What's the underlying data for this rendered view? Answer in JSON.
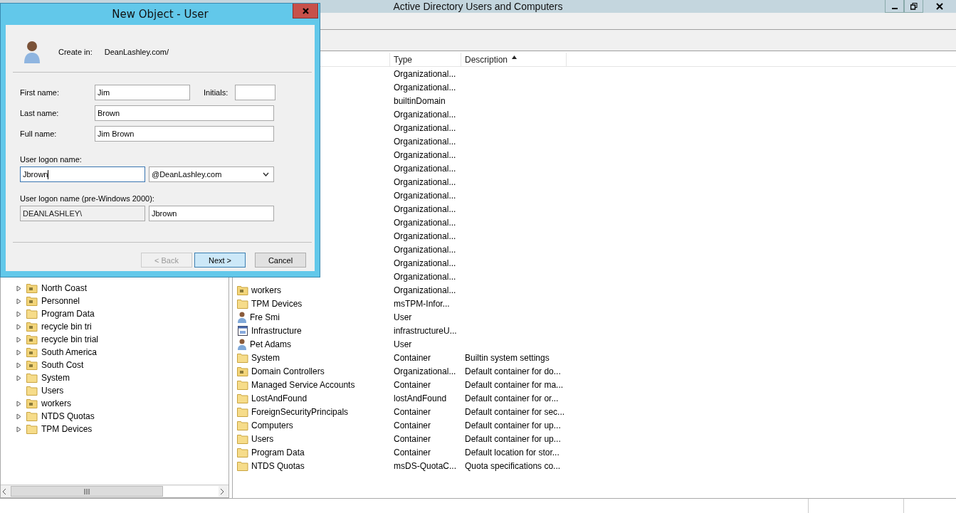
{
  "main_window": {
    "title": "Active Directory Users and Computers"
  },
  "tree": {
    "items": [
      {
        "label": "North Coast",
        "kind": "ou",
        "expandable": true
      },
      {
        "label": "Personnel",
        "kind": "ou",
        "expandable": true
      },
      {
        "label": "Program Data",
        "kind": "container",
        "expandable": true
      },
      {
        "label": "recycle bin tri",
        "kind": "ou",
        "expandable": true
      },
      {
        "label": "recycle bin trial",
        "kind": "ou",
        "expandable": true
      },
      {
        "label": "South America",
        "kind": "ou",
        "expandable": true
      },
      {
        "label": "South Cost",
        "kind": "ou",
        "expandable": true
      },
      {
        "label": "System",
        "kind": "container",
        "expandable": true
      },
      {
        "label": "Users",
        "kind": "container",
        "expandable": false
      },
      {
        "label": "workers",
        "kind": "ou",
        "expandable": true
      },
      {
        "label": "NTDS Quotas",
        "kind": "container",
        "expandable": true
      },
      {
        "label": "TPM Devices",
        "kind": "container",
        "expandable": true
      }
    ]
  },
  "list": {
    "columns": [
      {
        "label": "Type",
        "sorted": false
      },
      {
        "label": "Description",
        "sorted": true
      }
    ],
    "rows": [
      {
        "type": "Organizational..."
      },
      {
        "type": "Organizational..."
      },
      {
        "type": "builtinDomain"
      },
      {
        "type": "Organizational..."
      },
      {
        "type": "Organizational..."
      },
      {
        "type": "Organizational..."
      },
      {
        "type": "Organizational..."
      },
      {
        "type": "Organizational..."
      },
      {
        "type": "Organizational..."
      },
      {
        "type": "Organizational..."
      },
      {
        "type": "Organizational..."
      },
      {
        "type": "Organizational..."
      },
      {
        "type": "Organizational..."
      },
      {
        "type": "Organizational..."
      },
      {
        "type": "Organizational..."
      },
      {
        "type": "Organizational..."
      },
      {
        "kind": "ou",
        "name": "workers",
        "type": "Organizational..."
      },
      {
        "kind": "container",
        "name": "TPM Devices",
        "type": "msTPM-Infor..."
      },
      {
        "kind": "user",
        "name": "Fre Smi",
        "type": "User"
      },
      {
        "kind": "infrastructure",
        "name": "Infrastructure",
        "type": "infrastructureU..."
      },
      {
        "kind": "user",
        "name": "Pet Adams",
        "type": "User"
      },
      {
        "kind": "container",
        "name": "System",
        "type": "Container",
        "description": "Builtin system settings"
      },
      {
        "kind": "ou",
        "name": "Domain Controllers",
        "type": "Organizational...",
        "description": "Default container for do..."
      },
      {
        "kind": "container",
        "name": "Managed Service Accounts",
        "type": "Container",
        "description": "Default container for ma..."
      },
      {
        "kind": "container",
        "name": "LostAndFound",
        "type": "lostAndFound",
        "description": "Default container for or..."
      },
      {
        "kind": "container",
        "name": "ForeignSecurityPrincipals",
        "type": "Container",
        "description": "Default container for sec..."
      },
      {
        "kind": "container",
        "name": "Computers",
        "type": "Container",
        "description": "Default container for up..."
      },
      {
        "kind": "container",
        "name": "Users",
        "type": "Container",
        "description": "Default container for up..."
      },
      {
        "kind": "container",
        "name": "Program Data",
        "type": "Container",
        "description": "Default location for stor..."
      },
      {
        "kind": "container",
        "name": "NTDS Quotas",
        "type": "msDS-QuotaC...",
        "description": "Quota specifications co..."
      }
    ]
  },
  "dialog": {
    "title": "New Object - User",
    "create_in_label": "Create in:",
    "create_in_value": "DeanLashley.com/",
    "first_name": {
      "label": "First name:",
      "value": "Jim"
    },
    "initials": {
      "label": "Initials:"
    },
    "last_name": {
      "label": "Last name:",
      "value": "Brown"
    },
    "full_name": {
      "label": "Full name:",
      "value": "Jim Brown"
    },
    "logon_name": {
      "label": "User logon name:",
      "value": "Jbrown",
      "focused": true
    },
    "domain_suffix": {
      "value": "@DeanLashley.com"
    },
    "pre2000_label": "User logon name (pre-Windows 2000):",
    "pre2000_domain": {
      "value": "DEANLASHLEY\\",
      "disabled": true
    },
    "pre2000_name": {
      "value": "Jbrown",
      "disabled": false
    },
    "buttons": [
      {
        "label": "< Back",
        "disabled": true,
        "default": false
      },
      {
        "label": "Next >",
        "disabled": false,
        "default": true
      },
      {
        "label": "Cancel",
        "disabled": false,
        "default": false
      }
    ]
  }
}
